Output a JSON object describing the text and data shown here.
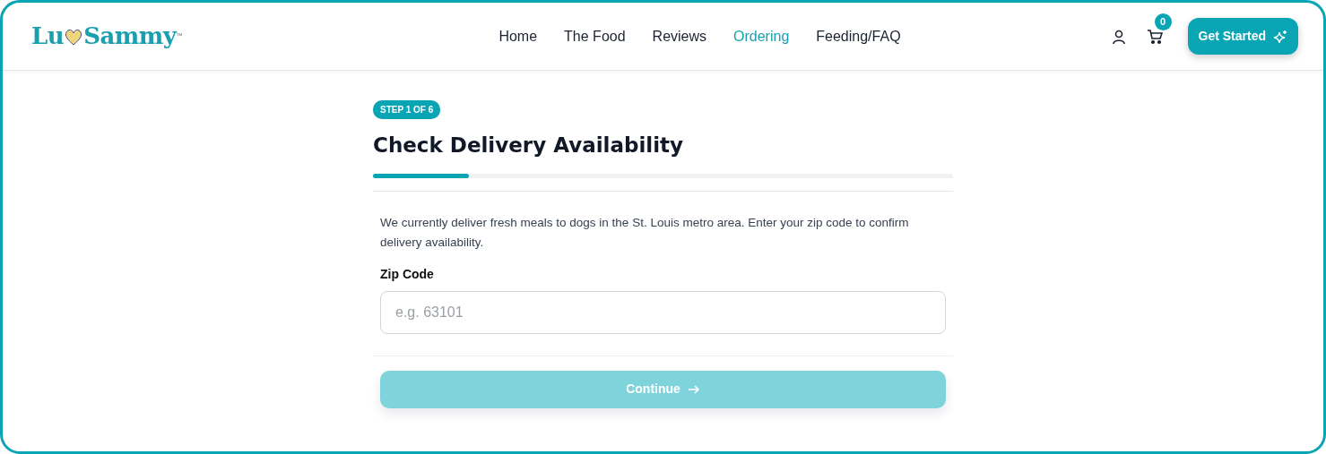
{
  "logo": {
    "before_heart": "Lu",
    "after_heart": "Sammy",
    "trademark": "™"
  },
  "nav": [
    {
      "label": "Home",
      "selected": false
    },
    {
      "label": "The Food",
      "selected": false
    },
    {
      "label": "Reviews",
      "selected": false
    },
    {
      "label": "Ordering",
      "selected": true
    },
    {
      "label": "Feeding/FAQ",
      "selected": false
    }
  ],
  "cart_count": "0",
  "cta": {
    "label": "Get Started"
  },
  "step_badge": "STEP 1 OF 6",
  "title": "Check Delivery Availability",
  "progress": {
    "level": 0.165
  },
  "intro": "We currently deliver fresh meals to dogs in the St. Louis metro area. Enter your zip code to confirm delivery availability.",
  "zip": {
    "label": "Zip Code",
    "placeholder": "e.g. 63101"
  },
  "continue": {
    "label": "Continue",
    "disabled": true
  }
}
